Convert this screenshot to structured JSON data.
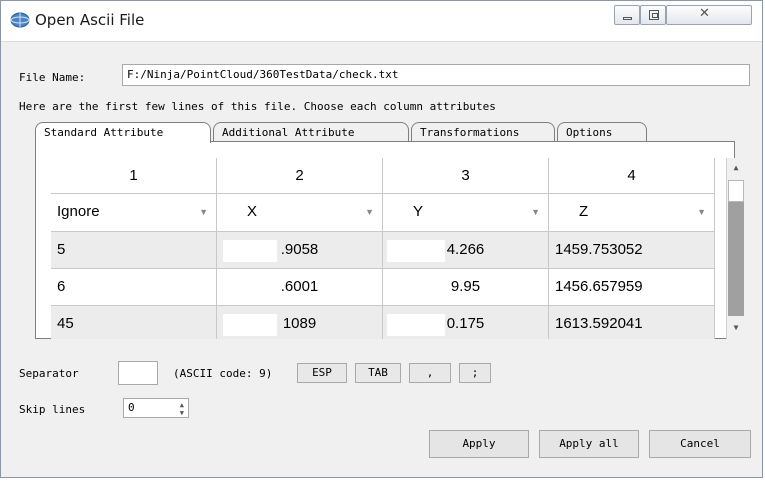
{
  "window": {
    "title": "Open Ascii File"
  },
  "file_name": {
    "label": "File Name:",
    "value": "F:/Ninja/PointCloud/360TestData/check.txt"
  },
  "instructions": "Here are the first few lines of this file. Choose each column attributes",
  "tabs": [
    {
      "label": "Standard Attribute"
    },
    {
      "label": "Additional Attribute"
    },
    {
      "label": "Transformations"
    },
    {
      "label": "Options"
    }
  ],
  "grid": {
    "columns": [
      "1",
      "2",
      "3",
      "4"
    ],
    "attributes": [
      "Ignore",
      "X",
      "Y",
      "Z"
    ],
    "rows": [
      [
        "5",
        ".9058",
        "4.266",
        "1459.753052"
      ],
      [
        "6",
        ".6001",
        "9.95",
        "1456.657959"
      ],
      [
        "45",
        "1089",
        "0.175",
        "1613.592041"
      ]
    ]
  },
  "separator": {
    "label": "Separator",
    "value": "",
    "ascii_code": "(ASCII code: 9)",
    "buttons": [
      "ESP",
      "TAB",
      ",",
      ";"
    ]
  },
  "skip_lines": {
    "label": "Skip lines",
    "value": "0"
  },
  "buttons": {
    "apply": "Apply",
    "apply_all": "Apply all",
    "cancel": "Cancel"
  },
  "icons": {
    "window": "app-globe-icon",
    "minimize": "minimize-icon",
    "maximize": "maximize-icon",
    "close": "close-icon",
    "dropdown": "chevron-down-icon",
    "scroll_up": "scroll-up-icon",
    "scroll_down": "scroll-down-icon",
    "spin_up": "spin-up-icon",
    "spin_down": "spin-down-icon"
  },
  "colors": {
    "row_alt": "#ececec",
    "scroll_track": "#a0a0a0",
    "titlebar": "#ffffff"
  }
}
